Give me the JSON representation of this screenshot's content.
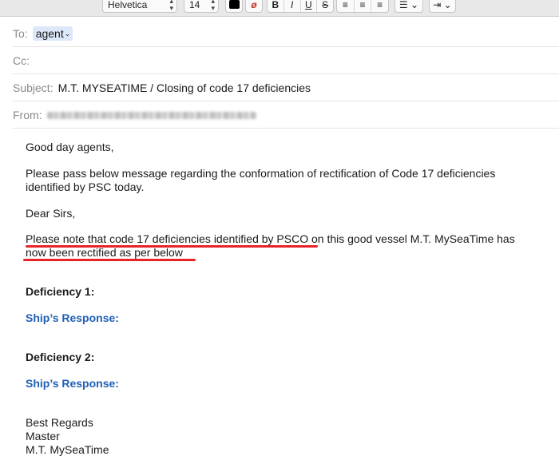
{
  "toolbar": {
    "font_name": "Helvetica",
    "font_size": "14",
    "text_color": "#000000",
    "style_buttons": [
      "B",
      "I",
      "U",
      "S"
    ],
    "align_buttons": [
      "align-left",
      "align-center",
      "align-right"
    ],
    "list_button": "list",
    "indent_button": "indent"
  },
  "header": {
    "to_label": "To:",
    "to_recipient": "agent",
    "cc_label": "Cc:",
    "subject_label": "Subject:",
    "subject": "M.T. MYSEATIME / Closing of code 17 deficiencies",
    "from_label": "From:"
  },
  "message": {
    "greeting": "Good day agents,",
    "intro": "Please pass below message regarding the conformation of rectification of Code 17 deficiencies\nidentified by PSC today.",
    "salutation": "Dear Sirs,",
    "note": "Please note that code 17 deficiencies identified by PSCO on this good vessel M.T. MySeaTime has\nnow been rectified as per below",
    "deficiency_1": "Deficiency 1:",
    "response_1": "Ship’s Response:",
    "deficiency_2": "Deficiency 2:",
    "response_2": "Ship’s Response:",
    "closing": "Best Regards",
    "signer_title": "Master",
    "signer_vessel": "M.T. MySeaTime"
  },
  "colors": {
    "accent_blue": "#1f5fb6",
    "annotation_red": "#e8232a",
    "recipient_token": "#dce7f9"
  }
}
